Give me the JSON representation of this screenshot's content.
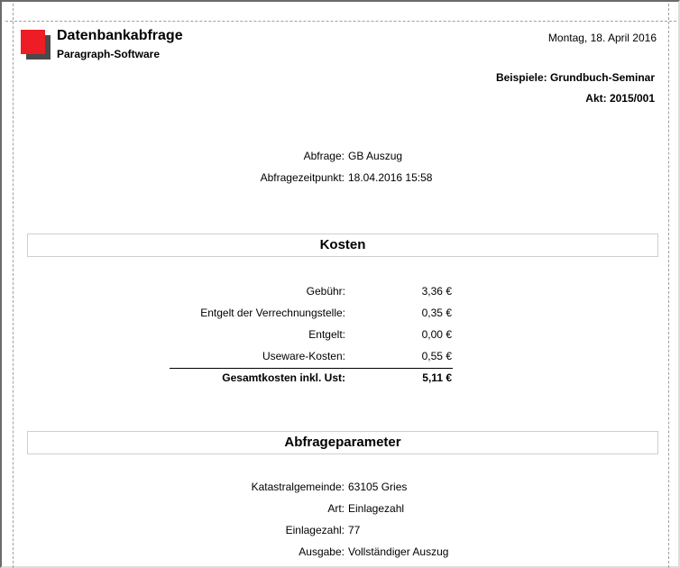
{
  "header": {
    "title": "Datenbankabfrage",
    "subtitle": "Paragraph-Software",
    "date": "Montag, 18. April 2016",
    "example": "Beispiele: Grundbuch-Seminar",
    "file_no": "Akt: 2015/001"
  },
  "query": {
    "abfrage_label": "Abfrage:",
    "abfrage_value": "GB Auszug",
    "zeitpunkt_label": "Abfragezeitpunkt:",
    "zeitpunkt_value": "18.04.2016 15:58"
  },
  "kosten": {
    "heading": "Kosten",
    "rows": [
      {
        "label": "Gebühr:",
        "amount": "3,36 €"
      },
      {
        "label": "Entgelt der Verrechnungstelle:",
        "amount": "0,35 €"
      },
      {
        "label": "Entgelt:",
        "amount": "0,00 €"
      },
      {
        "label": "Useware-Kosten:",
        "amount": "0,55 €"
      }
    ],
    "total_label": "Gesamtkosten inkl. Ust:",
    "total_amount": "5,11 €"
  },
  "parameter": {
    "heading": "Abfrageparameter",
    "rows": [
      {
        "label": "Katastralgemeinde:",
        "value": "63105 Gries"
      },
      {
        "label": "Art:",
        "value": "Einlagezahl"
      },
      {
        "label": "Einlagezahl:",
        "value": "77"
      },
      {
        "label": "Ausgabe:",
        "value": "Vollständiger Auszug"
      }
    ]
  },
  "colors": {
    "logo_red": "#ee1c25",
    "logo_shadow": "#4a4a4a",
    "section_border": "#cfcfcf"
  }
}
